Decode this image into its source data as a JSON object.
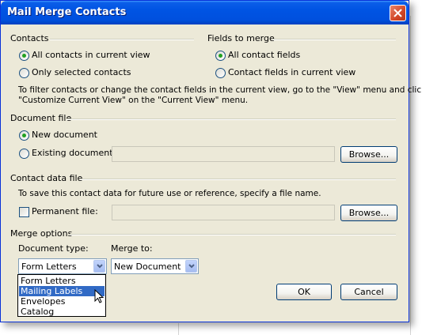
{
  "window": {
    "title": "Mail Merge Contacts"
  },
  "contacts": {
    "label": "Contacts",
    "options": [
      {
        "label": "All contacts in current view",
        "checked": true
      },
      {
        "label": "Only selected contacts",
        "checked": false
      }
    ]
  },
  "fields": {
    "label": "Fields to merge",
    "options": [
      {
        "label": "All contact fields",
        "checked": true
      },
      {
        "label": "Contact fields in current view",
        "checked": false
      }
    ]
  },
  "filter_info": {
    "line1": "To filter contacts or change the contact fields in the current view, go to the \"View\" menu and click",
    "line2": "\"Customize Current View\" on the \"Current View\" menu."
  },
  "document_file": {
    "label": "Document file",
    "new_label": "New document",
    "existing_label": "Existing document:",
    "browse_label": "Browse..."
  },
  "contact_data_file": {
    "label": "Contact data file",
    "info": "To save this contact data for future use or reference, specify a file name.",
    "permanent_label": "Permanent file:",
    "browse_label": "Browse..."
  },
  "merge_options": {
    "label": "Merge options",
    "doc_type_label": "Document type:",
    "doc_type_value": "Form Letters",
    "merge_to_label": "Merge to:",
    "merge_to_value": "New Document",
    "doc_type_options": [
      "Form Letters",
      "Mailing Labels",
      "Envelopes",
      "Catalog"
    ],
    "highlighted_option": "Mailing Labels"
  },
  "buttons": {
    "ok": "OK",
    "cancel": "Cancel"
  },
  "colors": {
    "titlebar": "#0054e3",
    "dialog_bg": "#ece9d8",
    "selection": "#316ac5",
    "radio_dot": "#21a121"
  }
}
